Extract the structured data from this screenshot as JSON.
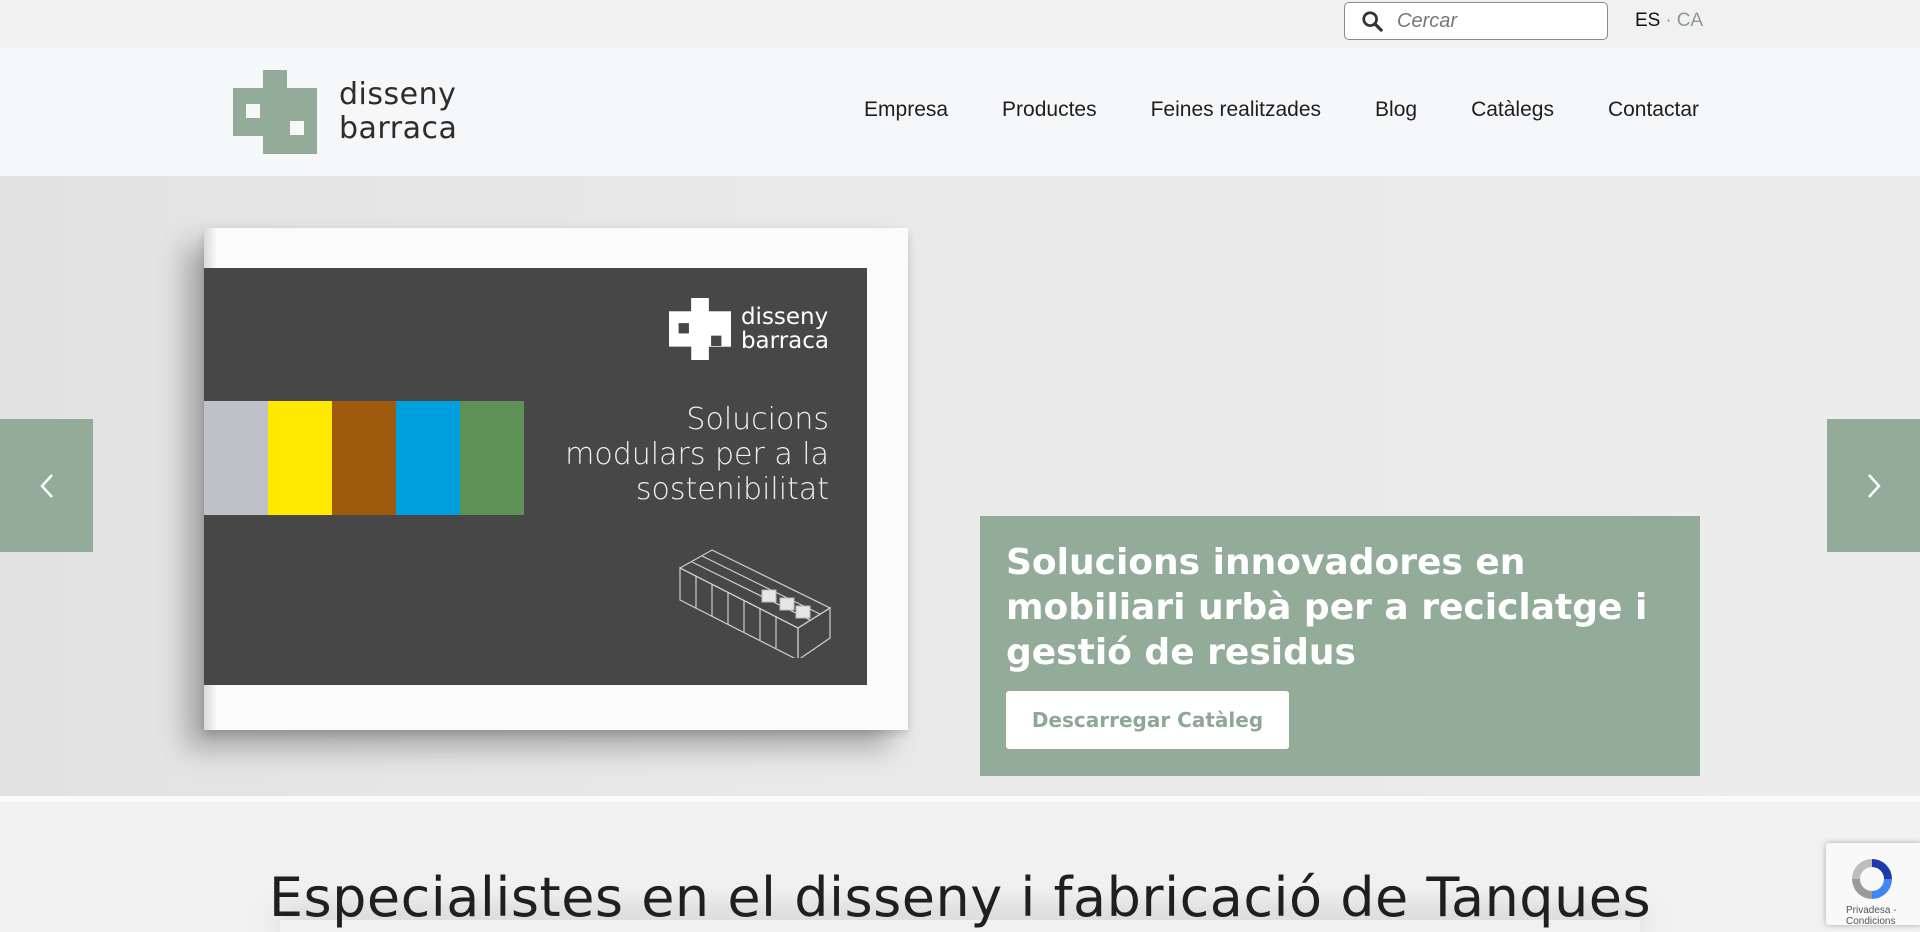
{
  "topbar": {
    "search_placeholder": "Cercar",
    "lang_es": "ES",
    "lang_sep": "·",
    "lang_ca": "CA"
  },
  "header": {
    "logo_line1": "disseny",
    "logo_line2": "barraca",
    "nav": [
      "Empresa",
      "Productes",
      "Feines realitzades",
      "Blog",
      "Catàlegs",
      "Contactar"
    ]
  },
  "hero": {
    "catalog_logo_line1": "disseny",
    "catalog_logo_line2": "barraca",
    "catalog_tagline": [
      "Solucions",
      "modulars per a la",
      "sostenibilitat"
    ],
    "stripe_colors": [
      "#c0c0c8",
      "#ffe900",
      "#a05a0d",
      "#00a0de",
      "#5d9156"
    ],
    "promo_title": "Solucions innovadores en mobiliari urbà per a reciclatge i gestió de residus",
    "promo_button": "Descarregar Catàleg"
  },
  "section": {
    "title": "Especialistes en el disseny i fabricació de Tanques"
  },
  "recaptcha": {
    "line1": "Privadesa -",
    "line2": "Condicions"
  },
  "colors": {
    "accent": "#93ac9a",
    "catalog_bg": "#474748"
  }
}
